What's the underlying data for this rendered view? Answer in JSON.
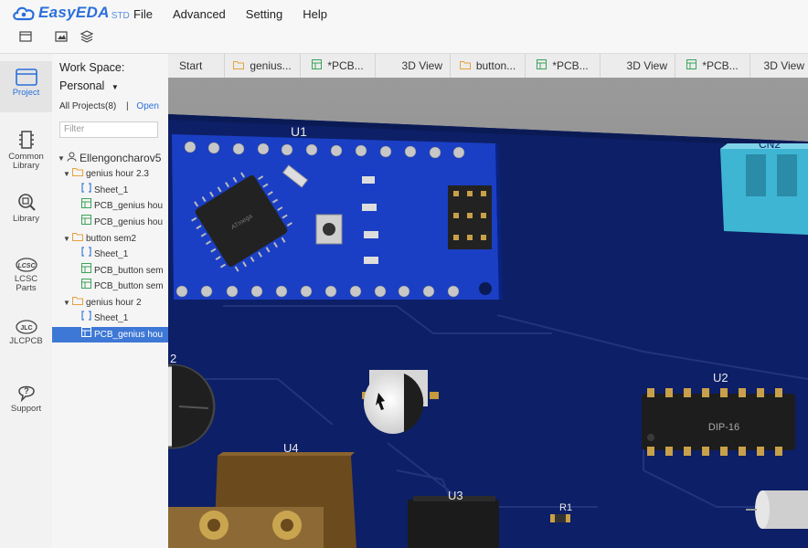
{
  "app": {
    "name": "EasyEDA",
    "edition": "STD"
  },
  "menu": [
    "File",
    "Advanced",
    "Setting",
    "Help"
  ],
  "leftnav": {
    "project": "Project",
    "common_library": "Common Library",
    "library": "Library",
    "lcsc_parts": "LCSC Parts",
    "jlcpcb": "JLCPCB",
    "support": "Support"
  },
  "workspace": {
    "title": "Work Space:",
    "selected": "Personal",
    "all_projects": "All Projects(8)",
    "separator": "|",
    "open_link": "Open",
    "filter_placeholder": "Filter"
  },
  "tree": {
    "user": "Ellengoncharov5",
    "projects": [
      {
        "name": "genius hour 2.3",
        "items": [
          "Sheet_1",
          "PCB_genius hou",
          "PCB_genius hou"
        ]
      },
      {
        "name": "button sem2",
        "items": [
          "Sheet_1",
          "PCB_button sem",
          "PCB_button sem"
        ]
      },
      {
        "name": "genius hour 2",
        "items": [
          "Sheet_1",
          "PCB_genius hou"
        ]
      }
    ]
  },
  "tabs": [
    "Start",
    "genius...",
    "*PCB...",
    "3D View",
    "button...",
    "*PCB...",
    "3D View",
    "*PCB...",
    "3D View"
  ],
  "board": {
    "labels": {
      "u1": "U1",
      "cn2": "CN2",
      "u2": "U2",
      "u3": "U3",
      "u4": "U4",
      "r1": "R1",
      "partial_2": "2"
    },
    "chip_text": "DIP-16",
    "mcu_text": "ATmega"
  }
}
